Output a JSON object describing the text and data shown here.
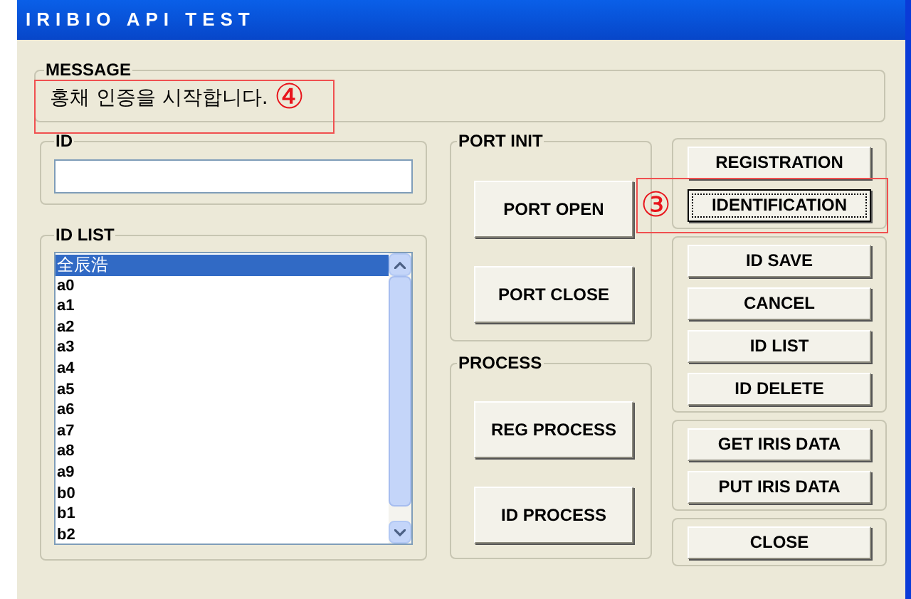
{
  "window": {
    "title": "IRIBIO API TEST"
  },
  "message": {
    "label": "MESSAGE",
    "text": "홍채 인증을 시작합니다.",
    "callout": "④"
  },
  "id_field": {
    "label": "ID"
  },
  "id_list": {
    "label": "ID LIST",
    "items": [
      {
        "text": "全辰浩",
        "selected": true
      },
      {
        "text": "a0",
        "selected": false
      },
      {
        "text": "a1",
        "selected": false
      },
      {
        "text": "a2",
        "selected": false
      },
      {
        "text": "a3",
        "selected": false
      },
      {
        "text": "a4",
        "selected": false
      },
      {
        "text": "a5",
        "selected": false
      },
      {
        "text": "a6",
        "selected": false
      },
      {
        "text": "a7",
        "selected": false
      },
      {
        "text": "a8",
        "selected": false
      },
      {
        "text": "a9",
        "selected": false
      },
      {
        "text": "b0",
        "selected": false
      },
      {
        "text": "b1",
        "selected": false
      },
      {
        "text": "b2",
        "selected": false
      }
    ]
  },
  "port_init": {
    "label": "PORT INIT",
    "buttons": [
      "PORT OPEN",
      "PORT CLOSE"
    ]
  },
  "process": {
    "label": "PROCESS",
    "buttons": [
      "REG PROCESS",
      "ID PROCESS"
    ]
  },
  "button_groups": [
    {
      "buttons": [
        {
          "label": "REGISTRATION",
          "focused": false
        },
        {
          "label": "IDENTIFICATION",
          "focused": true,
          "callout": "③"
        }
      ]
    },
    {
      "buttons": [
        {
          "label": "ID SAVE",
          "focused": false
        },
        {
          "label": "CANCEL",
          "focused": false
        },
        {
          "label": "ID LIST",
          "focused": false
        },
        {
          "label": "ID DELETE",
          "focused": false
        }
      ]
    },
    {
      "buttons": [
        {
          "label": "GET IRIS DATA",
          "focused": false
        },
        {
          "label": "PUT IRIS DATA",
          "focused": false
        }
      ]
    },
    {
      "buttons": [
        {
          "label": "CLOSE",
          "focused": false
        }
      ]
    }
  ]
}
